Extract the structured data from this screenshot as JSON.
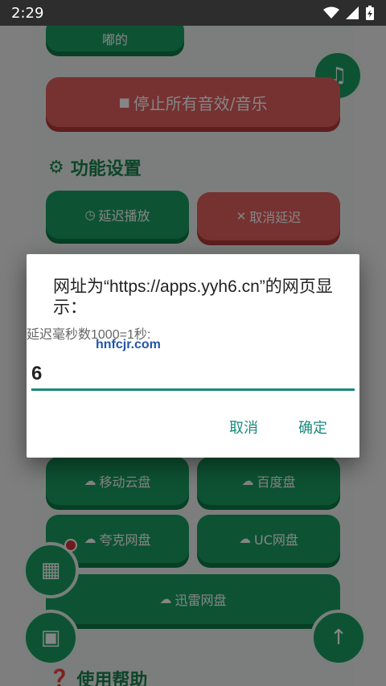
{
  "status": {
    "time": "2:29"
  },
  "background": {
    "partial_button_label": "嘟的",
    "stop_all_label": "停止所有音效/音乐",
    "section_settings": "功能设置",
    "delay_play_label": "延迟播放",
    "cancel_delay_label": "取消延迟",
    "cloud_buttons": [
      "移动云盘",
      "百度盘",
      "夸克网盘",
      "UC网盘",
      "迅雷网盘"
    ],
    "section_help": "使用帮助"
  },
  "dialog": {
    "title": "网址为“https://apps.yyh6.cn”的网页显示：",
    "message": "延迟毫秒数1000=1秒:",
    "watermark": "hnfcjr.com",
    "input_value": "6",
    "cancel_label": "取消",
    "ok_label": "确定"
  },
  "colors": {
    "accent": "#1a8a7f",
    "green": "#1aa063",
    "red": "#e25e5e"
  }
}
